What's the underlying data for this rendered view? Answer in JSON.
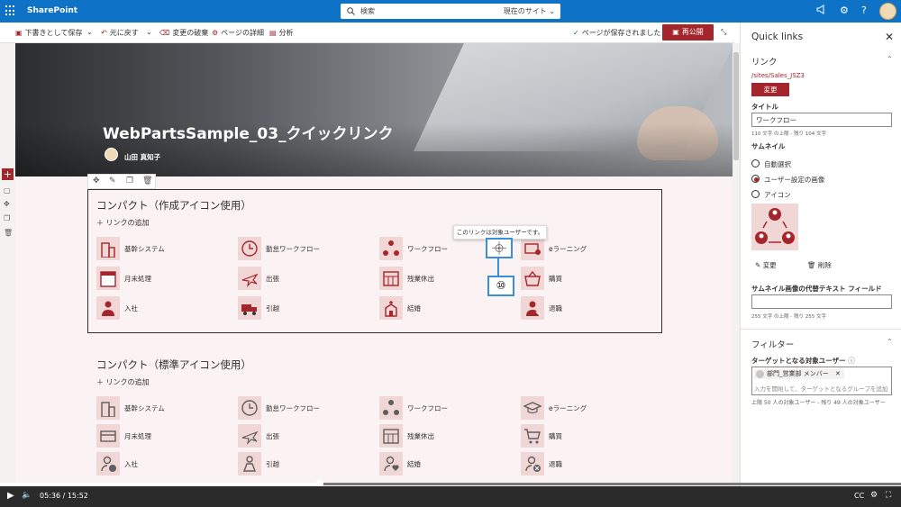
{
  "suite": {
    "brand": "SharePoint",
    "search_placeholder": "検索",
    "search_scope": "現在のサイト"
  },
  "toolbar": {
    "save_draft": "下書きとして保存",
    "undo": "元に戻す",
    "discard": "変更の破棄",
    "page_details": "ページの詳細",
    "analytics": "分析",
    "saved_status": "ページが保存されました",
    "republish": "再公開"
  },
  "page": {
    "title": "WebPartsSample_03_クイックリンク",
    "author": "山田 真知子"
  },
  "section1": {
    "heading": "コンパクト（作成アイコン使用）",
    "add_link": "リンクの追加",
    "items": [
      {
        "label": "基幹システム",
        "icon": "building-icon"
      },
      {
        "label": "勤怠ワークフロー",
        "icon": "clock-icon"
      },
      {
        "label": "ワークフロー",
        "icon": "workflow-icon"
      },
      {
        "label": "eラーニング",
        "icon": "elearning-icon"
      },
      {
        "label": "月末処理",
        "icon": "calendar-icon"
      },
      {
        "label": "出張",
        "icon": "airplane-icon"
      },
      {
        "label": "残業休出",
        "icon": "calendar-grid-icon"
      },
      {
        "label": "購買",
        "icon": "basket-icon"
      },
      {
        "label": "入社",
        "icon": "person-icon"
      },
      {
        "label": "引越",
        "icon": "truck-icon"
      },
      {
        "label": "結婚",
        "icon": "church-icon"
      },
      {
        "label": "退職",
        "icon": "person-exit-icon"
      }
    ],
    "tooltip": "このリンクは対象ユーザーです。",
    "callout_number": "⑩"
  },
  "section2": {
    "heading": "コンパクト（標準アイコン使用）",
    "add_link": "リンクの追加",
    "items": [
      {
        "label": "基幹システム",
        "icon": "building-icon"
      },
      {
        "label": "勤怠ワークフロー",
        "icon": "clock-icon"
      },
      {
        "label": "ワークフロー",
        "icon": "workflow-icon"
      },
      {
        "label": "eラーニング",
        "icon": "graduation-cap-icon"
      },
      {
        "label": "月末処理",
        "icon": "card-icon"
      },
      {
        "label": "出張",
        "icon": "airplane-icon"
      },
      {
        "label": "残業休出",
        "icon": "calendar-grid-icon"
      },
      {
        "label": "購買",
        "icon": "cart-icon"
      },
      {
        "label": "入社",
        "icon": "person-add-icon"
      },
      {
        "label": "引越",
        "icon": "person-move-icon"
      },
      {
        "label": "結婚",
        "icon": "person-heart-icon"
      },
      {
        "label": "退職",
        "icon": "person-remove-icon"
      }
    ]
  },
  "panel": {
    "title": "Quick links",
    "link_section": "リンク",
    "url": "/sites/Sales_JSZ3",
    "change_btn": "変更",
    "title_label": "タイトル",
    "title_value": "ワークフロー",
    "title_count": "110 文字 の上限 - 残り 104 文字",
    "thumb_label": "サムネイル",
    "thumb_options": [
      "自動選択",
      "ユーザー設定の画像",
      "アイコン"
    ],
    "thumb_selected": 1,
    "thumb_change": "変更",
    "thumb_delete": "削除",
    "alt_label": "サムネイル画像の代替テキスト フィールド",
    "alt_count": "255 文字 の上限 - 残り 255 文字",
    "filter_section": "フィルター",
    "target_label": "ターゲットとなる対象ユーザー",
    "target_chip": "部門_営業部 メンバー",
    "target_placeholder": "入力を開始して、ターゲットとなるグループを追加",
    "target_count": "上限 50 人の対象ユーザー - 残り 49 人の対象ユーザー"
  },
  "video": {
    "time": "05:36 / 15:52",
    "progress": 0.355
  },
  "colors": {
    "suite": "#0e73c6",
    "accent": "#a4262c",
    "icon_bg": "#f1d6d6"
  }
}
